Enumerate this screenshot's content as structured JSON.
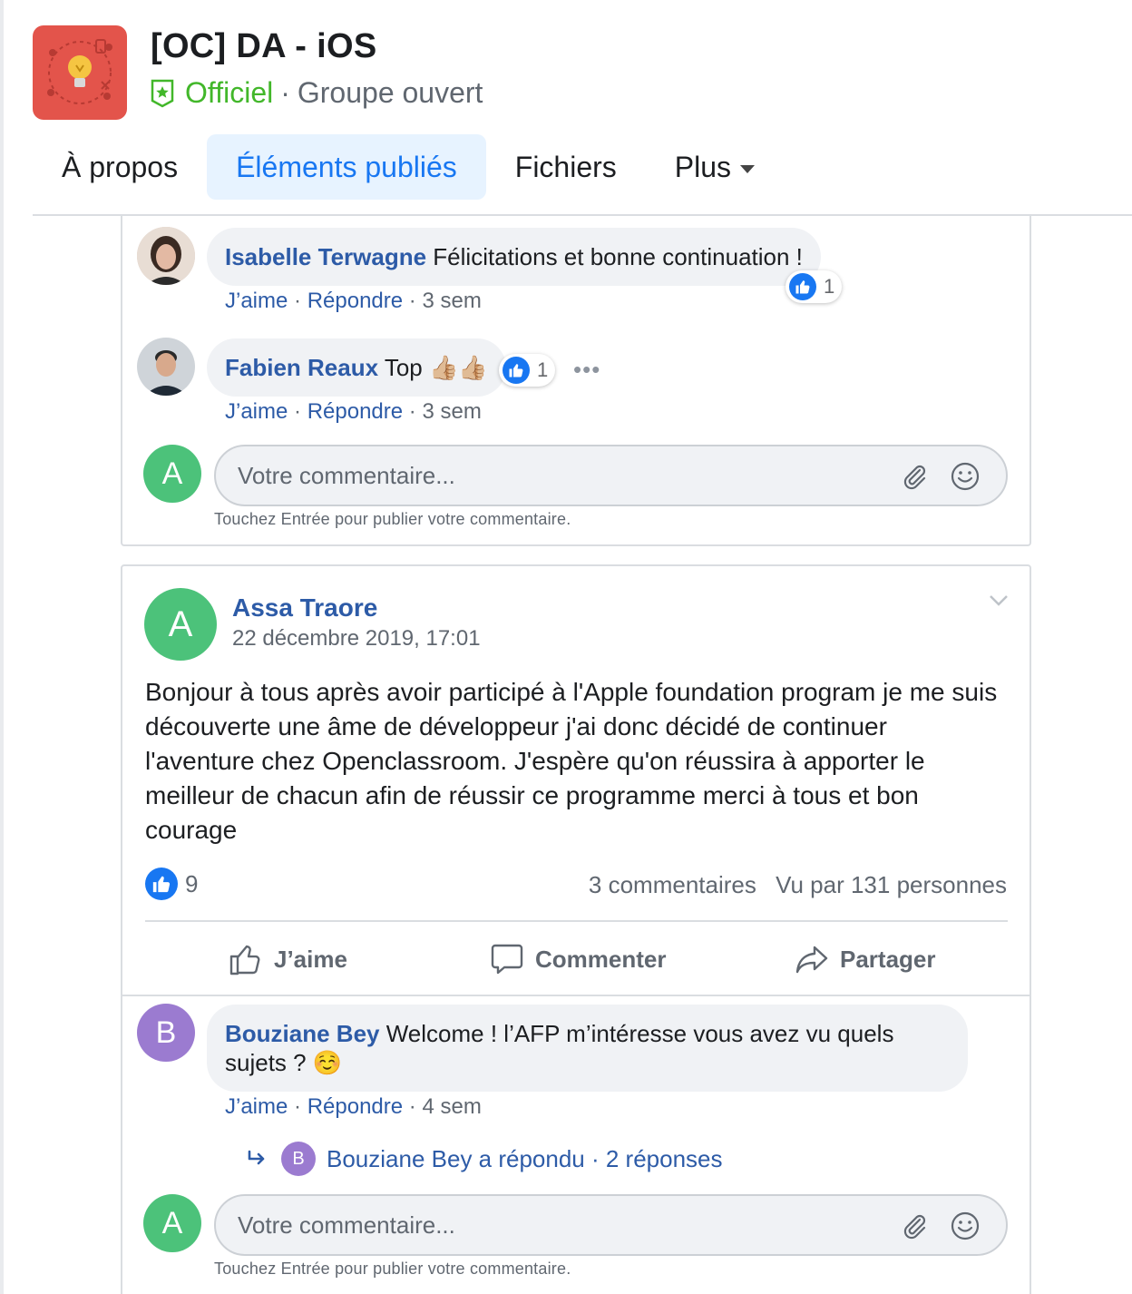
{
  "group": {
    "title": "[OC] DA - iOS",
    "official_label": "Officiel",
    "separator": "·",
    "privacy": "Groupe ouvert"
  },
  "tabs": [
    {
      "label": "À propos",
      "active": false
    },
    {
      "label": "Éléments publiés",
      "active": true
    },
    {
      "label": "Fichiers",
      "active": false
    },
    {
      "label": "Plus",
      "active": false
    }
  ],
  "comments_top": [
    {
      "author": "Isabelle Terwagne",
      "text": "Félicitations et bonne continuation !",
      "like_label": "J’aime",
      "reply_label": "Répondre",
      "time": "3 sem",
      "reactions": "1"
    },
    {
      "author": "Fabien Reaux",
      "text": "Top 👍🏼👍🏼",
      "like_label": "J’aime",
      "reply_label": "Répondre",
      "time": "3 sem",
      "reactions": "1"
    }
  ],
  "composer": {
    "avatar_letter": "A",
    "placeholder": "Votre commentaire...",
    "hint": "Touchez Entrée pour publier votre commentaire."
  },
  "post": {
    "avatar_letter": "A",
    "author": "Assa Traore",
    "date": "22 décembre 2019, 17:01",
    "body": "Bonjour à tous après avoir participé à l'Apple foundation program je me suis découverte une âme de développeur j'ai donc décidé de continuer l'aventure chez Openclassroom. J'espère qu'on réussira à apporter le meilleur de chacun afin de réussir ce programme merci à tous et bon courage",
    "likes": "9",
    "comments_count": "3 commentaires",
    "views": "Vu par 131 personnes",
    "actions": {
      "like": "J’aime",
      "comment": "Commenter",
      "share": "Partager"
    }
  },
  "post_comment": {
    "avatar_letter": "B",
    "author": "Bouziane Bey",
    "text": "Welcome ! l’AFP m’intéresse vous avez vu quels sujets ? ☺️",
    "like_label": "J’aime",
    "reply_label": "Répondre",
    "time": "4 sem",
    "replies": {
      "avatar_letter": "B",
      "text": "Bouziane Bey a répondu · 2 réponses"
    }
  },
  "colors": {
    "link": "#2d5ba7",
    "official_green": "#42b72a",
    "like_blue": "#1877f2",
    "avatar_green": "#4cc27a",
    "avatar_purple": "#9b7bd0",
    "logo_red": "#e3544b"
  }
}
